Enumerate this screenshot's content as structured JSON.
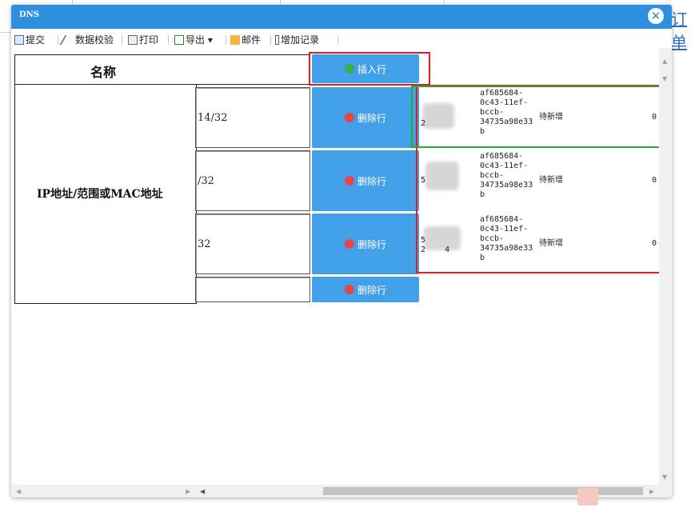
{
  "window": {
    "title": "DNS"
  },
  "background_link": {
    "text": "订单"
  },
  "toolbar": {
    "items": [
      {
        "label": "提交",
        "icon": "save-icon"
      },
      {
        "label": "数据校验",
        "icon": "wand-icon"
      },
      {
        "label": "打印",
        "icon": "printer-icon"
      },
      {
        "label": "导出 ▾",
        "icon": "export-icon"
      },
      {
        "label": "邮件",
        "icon": "mail-icon"
      },
      {
        "label": "增加记录",
        "icon": "add-record-icon"
      }
    ]
  },
  "form": {
    "name_header": "名称",
    "ip_header": "IP地址/范围或MAC地址",
    "insert_button": "插入行",
    "delete_button": "删除行",
    "rows": [
      {
        "value": "14/32"
      },
      {
        "value": "/32"
      },
      {
        "value": "32"
      },
      {
        "value": ""
      }
    ]
  },
  "sub_rows": [
    {
      "left_top": "",
      "left_bottom": "2",
      "id_lines": [
        "af685684-",
        "0c43-11ef-",
        "bccb-",
        "34735a98e33",
        "b"
      ],
      "status": "待新增",
      "count": "0"
    },
    {
      "left_top": "5",
      "left_bottom": "",
      "id_lines": [
        "af685684-",
        "0c43-11ef-",
        "bccb-",
        "34735a98e33",
        "b"
      ],
      "status": "待新增",
      "count": "0"
    },
    {
      "left_top": "5",
      "left_bottom": "2    4",
      "id_lines": [
        "af685684-",
        "0c43-11ef-",
        "bccb-",
        "34735a98e33",
        "b"
      ],
      "status": "待新增",
      "count": "0"
    }
  ],
  "colors": {
    "title_bar": "#2f8fdf",
    "button": "#42a0e8",
    "highlight_red": "#e02020",
    "highlight_green": "#20b030"
  }
}
